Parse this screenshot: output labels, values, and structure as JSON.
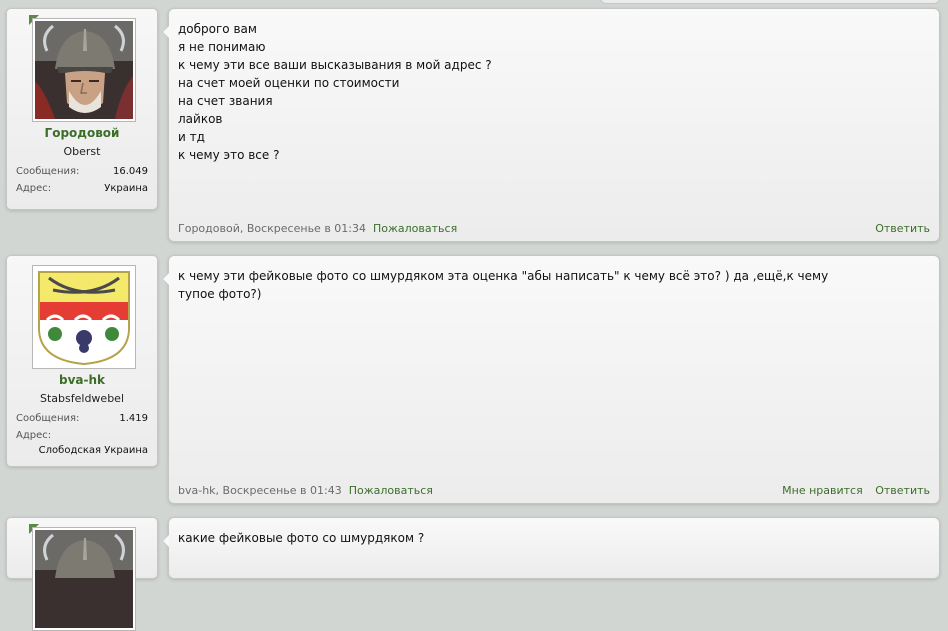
{
  "posts": [
    {
      "user": {
        "name": "Городовой",
        "rank": "Oberst",
        "messages_label": "Сообщения:",
        "messages": "16.049",
        "address_label": "Адрес:",
        "address": "Украина"
      },
      "lines": [
        "доброго вам",
        "я не понимаю",
        "к чему эти все ваши высказывания в мой адрес ?",
        "на счет моей оценки по стоимости",
        "на счет звания",
        "лайков",
        "и тд",
        "к чему это все ?"
      ],
      "meta_text": "Городовой, Воскресенье в 01:34",
      "report": "Пожаловаться",
      "reply": "Ответить"
    },
    {
      "user": {
        "name": "bva-hk",
        "rank": "Stabsfeldwebel",
        "messages_label": "Сообщения:",
        "messages": "1.419",
        "address_label": "Адрес:",
        "address": "Слободская Украина"
      },
      "lines": [
        "к чему эти фейковые фото со шмурдяком эта оценка \"абы написать\" к чему всё это? ) да ,ещё,к чему",
        "тупое фото?)"
      ],
      "meta_text": "bva-hk, Воскресенье в 01:43",
      "report": "Пожаловаться",
      "like": "Мне нравится",
      "reply": "Ответить"
    },
    {
      "lines": [
        "какие фейковые фото со шмурдяком ?"
      ]
    }
  ]
}
